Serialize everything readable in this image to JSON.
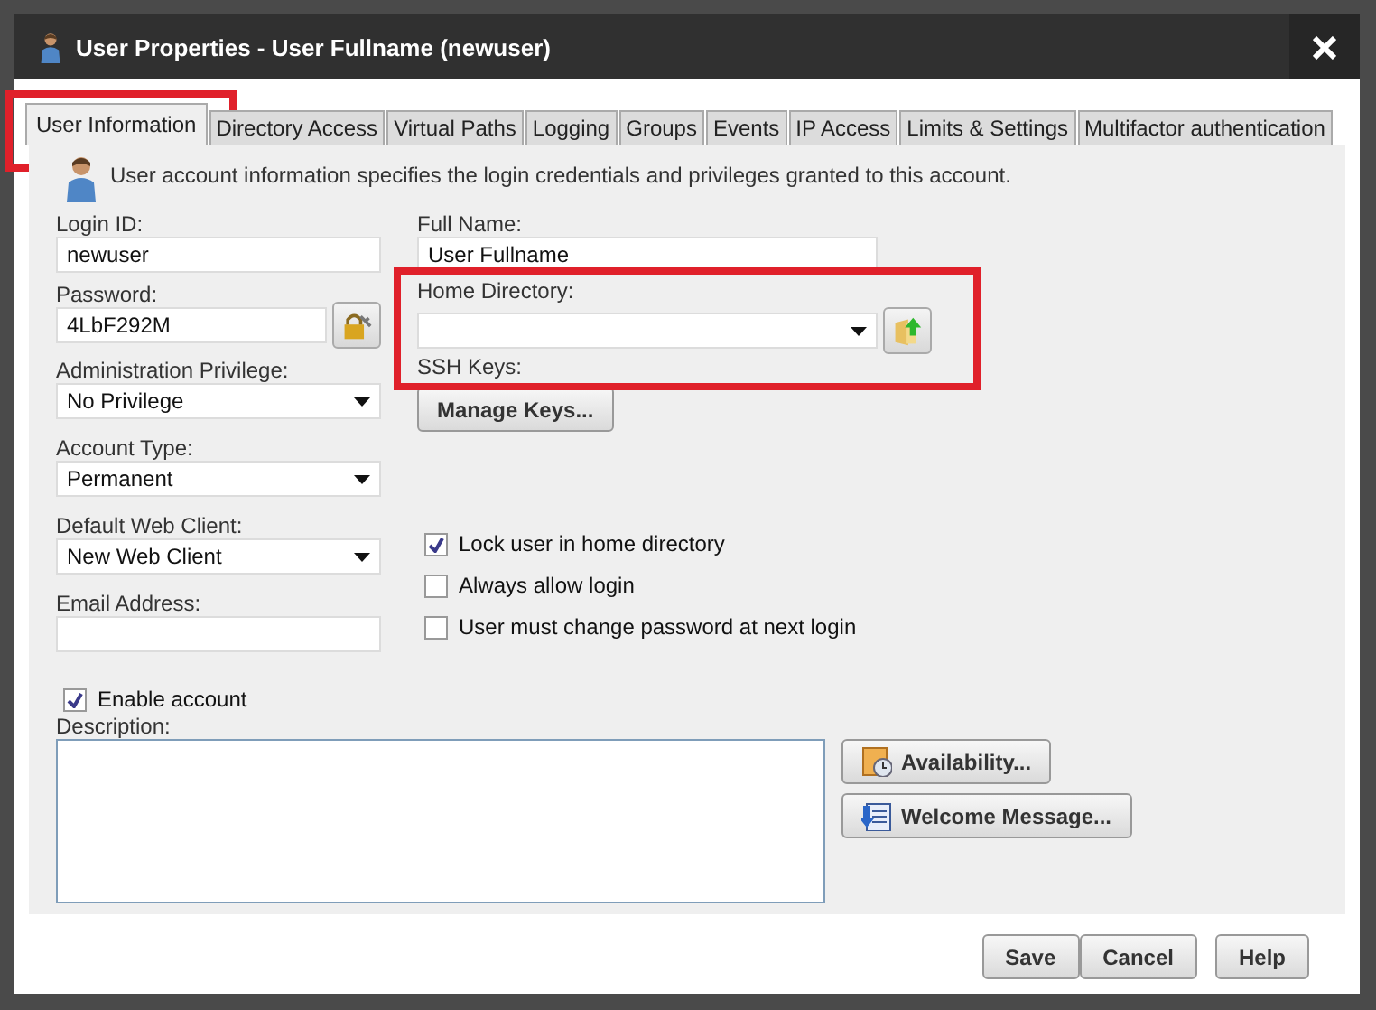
{
  "window": {
    "title": "User Properties - User Fullname (newuser)"
  },
  "tabs": [
    {
      "label": "User Information",
      "selected": true,
      "highlighted": true
    },
    {
      "label": "Directory Access",
      "selected": false,
      "highlighted": false
    },
    {
      "label": "Virtual Paths",
      "selected": false,
      "highlighted": false
    },
    {
      "label": "Logging",
      "selected": false,
      "highlighted": false
    },
    {
      "label": "Groups",
      "selected": false,
      "highlighted": false
    },
    {
      "label": "Events",
      "selected": false,
      "highlighted": false
    },
    {
      "label": "IP Access",
      "selected": false,
      "highlighted": false
    },
    {
      "label": "Limits & Settings",
      "selected": false,
      "highlighted": false
    },
    {
      "label": "Multifactor authentication",
      "selected": false,
      "highlighted": false
    }
  ],
  "intro": "User account information specifies the login credentials and privileges granted to this account.",
  "left_fields": [
    {
      "kind": "input",
      "label": "Login ID:",
      "value": "newuser"
    },
    {
      "kind": "input-with-button",
      "label": "Password:",
      "value": "4LbF292M"
    },
    {
      "kind": "select",
      "label": "Administration Privilege:",
      "value": "No Privilege"
    },
    {
      "kind": "select",
      "label": "Account Type:",
      "value": "Permanent"
    },
    {
      "kind": "select",
      "label": "Default Web Client:",
      "value": "New Web Client"
    },
    {
      "kind": "input",
      "label": "Email Address:"
    }
  ],
  "full_name": {
    "label": "Full Name:",
    "value": "User Fullname"
  },
  "home_directory": {
    "label": "Home Directory:",
    "highlighted": true
  },
  "ssh_keys": {
    "label": "SSH Keys:",
    "button": "Manage Keys..."
  },
  "options": [
    {
      "label": "Lock user in home directory",
      "checked": true
    },
    {
      "label": "Always allow login",
      "checked": false
    },
    {
      "label": "User must change password at next login",
      "checked": false
    }
  ],
  "enable_account": {
    "label": "Enable account",
    "checked": true
  },
  "description": {
    "label": "Description:"
  },
  "side_buttons": [
    {
      "kind": "availability",
      "label": "Availability..."
    },
    {
      "kind": "welcome",
      "label": "Welcome Message..."
    }
  ],
  "footer_buttons": [
    "Save",
    "Cancel",
    "Help"
  ]
}
